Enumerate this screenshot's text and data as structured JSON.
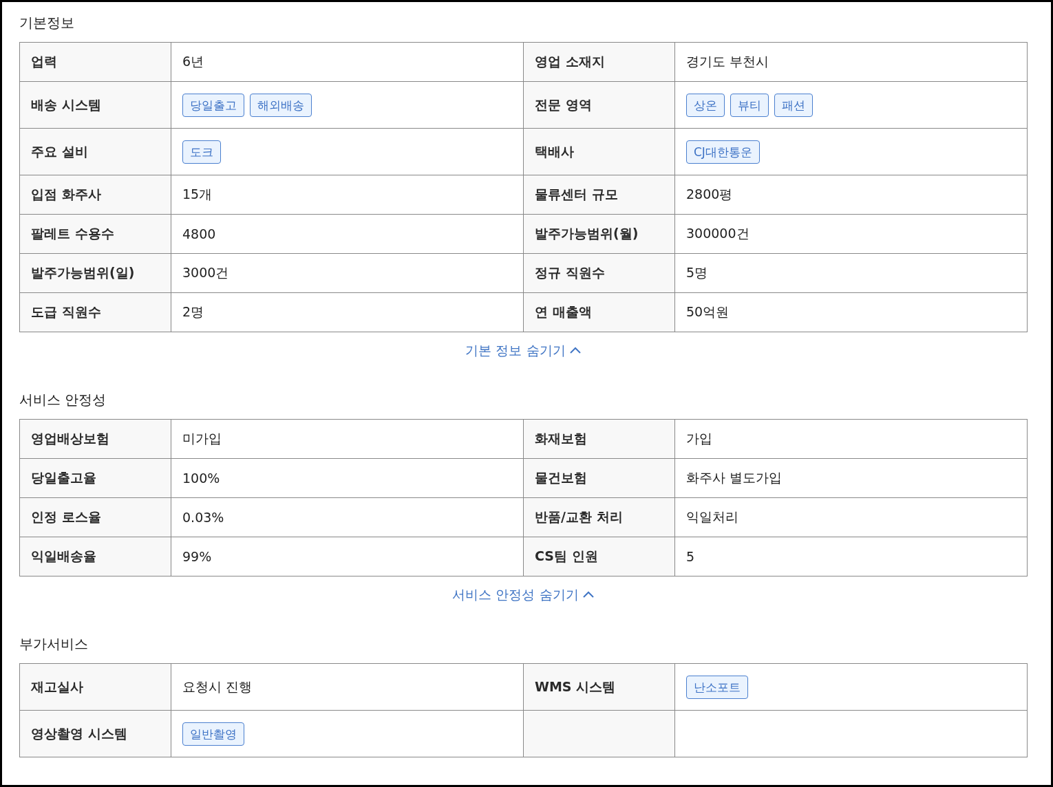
{
  "sections": [
    {
      "title": "기본정보",
      "rows": [
        {
          "items": [
            {
              "label": "업력",
              "kind": "text",
              "value": "6년"
            },
            {
              "label": "영업 소재지",
              "kind": "text",
              "value": "경기도 부천시"
            }
          ]
        },
        {
          "items": [
            {
              "label": "배송 시스템",
              "kind": "tags",
              "tags": [
                "당일출고",
                "해외배송"
              ]
            },
            {
              "label": "전문 영역",
              "kind": "tags",
              "tags": [
                "상온",
                "뷰티",
                "패션"
              ]
            }
          ]
        },
        {
          "items": [
            {
              "label": "주요 설비",
              "kind": "tags",
              "tags": [
                "도크"
              ]
            },
            {
              "label": "택배사",
              "kind": "tags",
              "tags": [
                "CJ대한통운"
              ]
            }
          ]
        },
        {
          "items": [
            {
              "label": "입점 화주사",
              "kind": "text",
              "value": "15개"
            },
            {
              "label": "물류센터 규모",
              "kind": "text",
              "value": "2800평"
            }
          ]
        },
        {
          "items": [
            {
              "label": "팔레트 수용수",
              "kind": "text",
              "value": "4800"
            },
            {
              "label": "발주가능범위(월)",
              "kind": "text",
              "value": "300000건"
            }
          ]
        },
        {
          "items": [
            {
              "label": "발주가능범위(일)",
              "kind": "text",
              "value": "3000건"
            },
            {
              "label": "정규 직원수",
              "kind": "text",
              "value": "5명"
            }
          ]
        },
        {
          "items": [
            {
              "label": "도급 직원수",
              "kind": "text",
              "value": "2명"
            },
            {
              "label": "연 매출액",
              "kind": "text",
              "value": "50억원"
            }
          ]
        }
      ],
      "toggle": {
        "text": "기본 정보 숨기기",
        "expanded": true
      }
    },
    {
      "title": "서비스 안정성",
      "rows": [
        {
          "items": [
            {
              "label": "영업배상보험",
              "kind": "text",
              "value": "미가입"
            },
            {
              "label": "화재보험",
              "kind": "text",
              "value": "가입"
            }
          ]
        },
        {
          "items": [
            {
              "label": "당일출고율",
              "kind": "text",
              "value": "100%"
            },
            {
              "label": "물건보험",
              "kind": "text",
              "value": "화주사 별도가입"
            }
          ]
        },
        {
          "items": [
            {
              "label": "인정 로스율",
              "kind": "text",
              "value": "0.03%"
            },
            {
              "label": "반품/교환 처리",
              "kind": "text",
              "value": "익일처리"
            }
          ]
        },
        {
          "items": [
            {
              "label": "익일배송율",
              "kind": "text",
              "value": "99%"
            },
            {
              "label": "CS팀 인원",
              "kind": "text",
              "value": "5"
            }
          ]
        }
      ],
      "toggle": {
        "text": "서비스 안정성 숨기기",
        "expanded": true
      }
    },
    {
      "title": "부가서비스",
      "rows": [
        {
          "items": [
            {
              "label": "재고실사",
              "kind": "text",
              "value": "요청시 진행"
            },
            {
              "label": "WMS 시스템",
              "kind": "tags",
              "tags": [
                "난소포트"
              ]
            }
          ]
        },
        {
          "items": [
            {
              "label": "영상촬영 시스템",
              "kind": "tags",
              "tags": [
                "일반촬영"
              ]
            }
          ]
        }
      ]
    }
  ]
}
